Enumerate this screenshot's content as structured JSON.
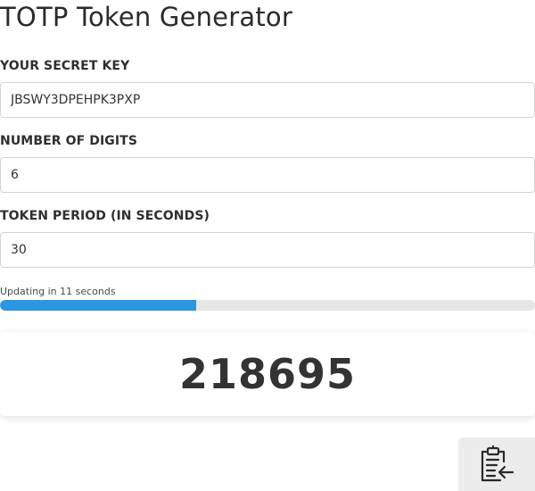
{
  "header": {
    "title": "TOTP Token Generator"
  },
  "fields": {
    "secret": {
      "label": "YOUR SECRET KEY",
      "value": "JBSWY3DPEHPK3PXP"
    },
    "digits": {
      "label": "NUMBER OF DIGITS",
      "value": "6"
    },
    "period": {
      "label": "TOKEN PERIOD (IN SECONDS)",
      "value": "30"
    }
  },
  "countdown": {
    "text": "Updating in 11 seconds",
    "progress_fraction": 0.366,
    "bar_color": "#2c96e0",
    "track_color": "#e6e6e6"
  },
  "token": {
    "value": "218695"
  },
  "copy_button": {
    "icon": "clipboard-paste-icon"
  }
}
